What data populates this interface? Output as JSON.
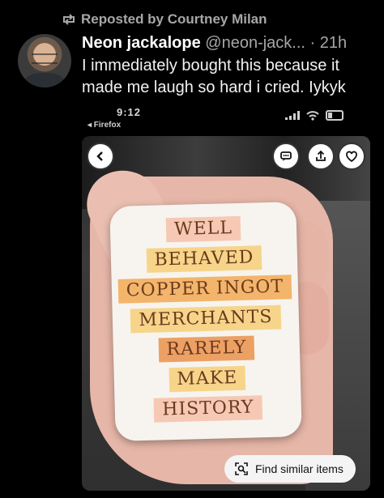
{
  "repost": {
    "text": "Reposted by Courtney Milan"
  },
  "post": {
    "author_name": "Neon jackalope",
    "handle": "@neon-jack...",
    "time": "· 21h",
    "body": "I immediately bought this because it made me laugh so hard i cried. Iykyk"
  },
  "phone": {
    "time": "9:12",
    "back_app": "◂ Firefox"
  },
  "sticker": {
    "lines": [
      {
        "text": "WELL",
        "bg": "#f6c9b5"
      },
      {
        "text": "BEHAVED",
        "bg": "#f6d58a"
      },
      {
        "text": "COPPER INGOT",
        "bg": "#f3b56b"
      },
      {
        "text": "MERCHANTS",
        "bg": "#f6d58a"
      },
      {
        "text": "RARELY",
        "bg": "#eda064"
      },
      {
        "text": "MAKE",
        "bg": "#f6d58a"
      },
      {
        "text": "HISTORY",
        "bg": "#f6c9b5"
      }
    ]
  },
  "find_similar": {
    "label": "Find similar items"
  },
  "icons": {
    "repost": "repost-icon",
    "back": "chevron-left-icon",
    "comment": "comment-icon",
    "share": "share-icon",
    "like": "heart-icon",
    "lens": "lens-icon",
    "signal": "signal-icon",
    "wifi": "wifi-icon",
    "battery": "battery-icon"
  }
}
